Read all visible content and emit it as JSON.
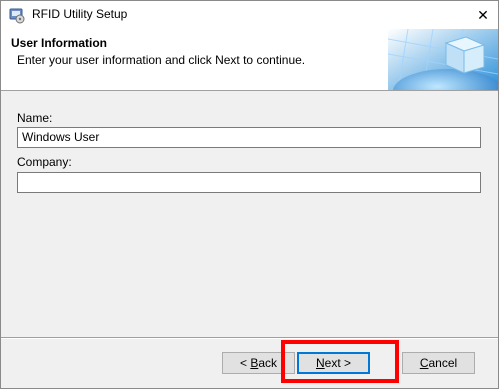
{
  "window": {
    "title": "RFID Utility Setup",
    "app_icon": "setup-installer-icon",
    "close_glyph": "✕"
  },
  "header": {
    "title": "User Information",
    "subtitle": "Enter your user information and click Next to continue.",
    "banner_icon": "3d-cube-globe-banner"
  },
  "form": {
    "name_label": "Name:",
    "name_value": "Windows User",
    "company_label": "Company:",
    "company_value": ""
  },
  "buttons": {
    "back_prefix": "< ",
    "back_mnemonic": "B",
    "back_rest": "ack",
    "next_mnemonic": "N",
    "next_rest": "ext >",
    "cancel_mnemonic": "C",
    "cancel_rest": "ancel"
  },
  "annotation": {
    "highlight_color": "#ff0000"
  }
}
